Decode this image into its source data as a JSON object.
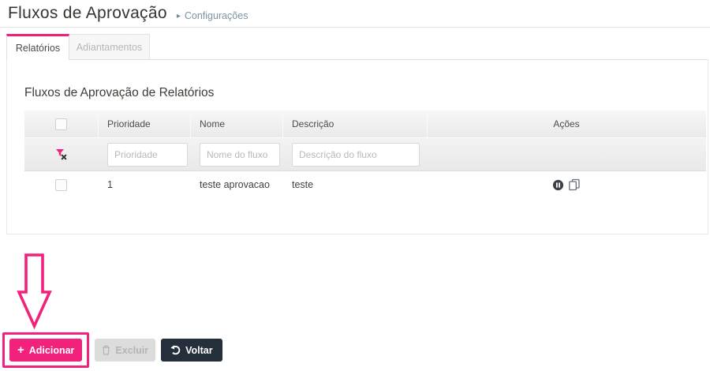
{
  "header": {
    "title": "Fluxos de Aprovação",
    "breadcrumb": {
      "arrow": "▸",
      "label": "Configurações"
    }
  },
  "tabs": [
    {
      "label": "Relatórios",
      "active": true
    },
    {
      "label": "Adiantamentos",
      "active": false
    }
  ],
  "panel": {
    "heading": "Fluxos de Aprovação de Relatórios",
    "table": {
      "columns": [
        "Prioridade",
        "Nome",
        "Descrição",
        "Ações"
      ],
      "filters": {
        "clear_icon": "filter-clear-icon",
        "prioridade_placeholder": "Prioridade",
        "nome_placeholder": "Nome do fluxo",
        "descricao_placeholder": "Descrição do fluxo"
      },
      "rows": [
        {
          "prioridade": "1",
          "nome": "teste aprovacao",
          "descricao": "teste",
          "acoes": [
            "pause-icon",
            "copy-icon"
          ]
        }
      ]
    }
  },
  "footer": {
    "adicionar": {
      "icon": "plus-icon",
      "icon_glyph": "+",
      "label": "Adicionar"
    },
    "excluir": {
      "icon": "trash-icon",
      "label": "Excluir",
      "disabled": true
    },
    "voltar": {
      "icon": "undo-icon",
      "label": "Voltar"
    }
  },
  "colors": {
    "accent_pink": "#f1217c",
    "dark_navy": "#252e3b",
    "breadcrumb_blue": "#7c94a4"
  }
}
